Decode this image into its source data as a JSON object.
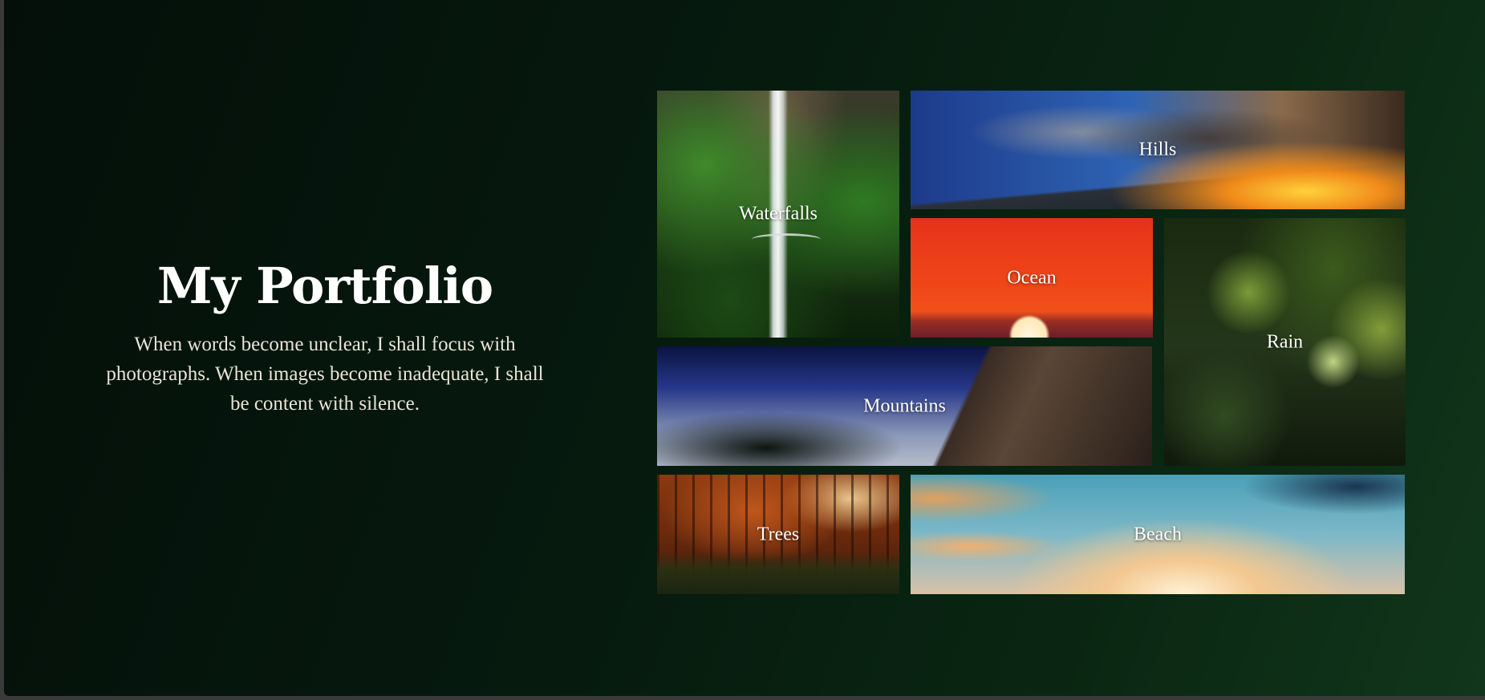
{
  "hero": {
    "title": "My Portfolio",
    "tagline": "When words become unclear, I shall focus with photographs. When images become inadequate, I shall be content with silence."
  },
  "gallery": {
    "tiles": [
      {
        "label": "Waterfalls"
      },
      {
        "label": "Hills"
      },
      {
        "label": "Ocean"
      },
      {
        "label": "Rain"
      },
      {
        "label": "Mountains"
      },
      {
        "label": "Trees"
      },
      {
        "label": "Beach"
      }
    ]
  },
  "colors": {
    "background_dark": "#040f09",
    "background_green": "#11361b",
    "text_light": "#ffffff"
  }
}
